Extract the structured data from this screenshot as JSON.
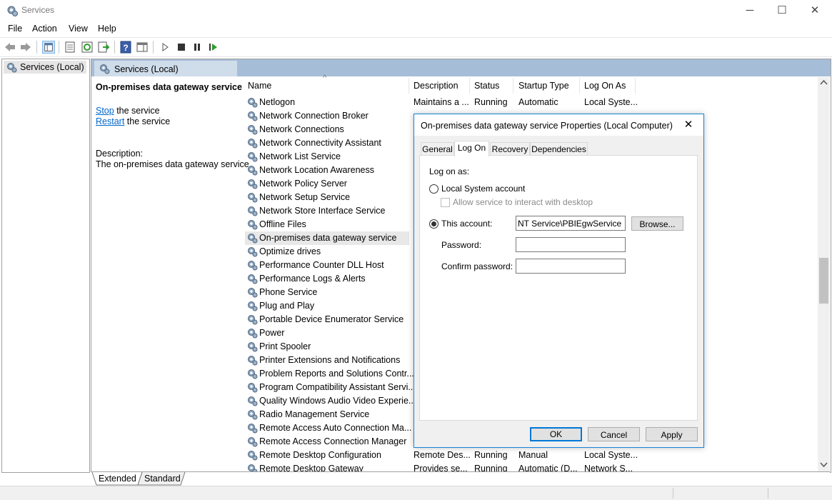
{
  "window": {
    "title": "Services",
    "minimize_glyph": "─",
    "maximize_glyph": "☐",
    "close_glyph": "✕"
  },
  "menu": [
    "File",
    "Action",
    "View",
    "Help"
  ],
  "tree": {
    "root_label": "Services (Local)"
  },
  "right_header": {
    "title": "Services (Local)"
  },
  "detail": {
    "service_name": "On-premises data gateway service",
    "stop_link": "Stop",
    "stop_suffix": " the service",
    "restart_link": "Restart",
    "restart_suffix": " the service",
    "description_label": "Description:",
    "description_text": "The on-premises data gateway service"
  },
  "columns": {
    "name": "Name",
    "description": "Description",
    "status": "Status",
    "startup_type": "Startup Type",
    "log_on_as": "Log On As",
    "sort_glyph": "^"
  },
  "services": [
    {
      "name": "Netlogon",
      "description": "Maintains a ...",
      "status": "Running",
      "startup": "Automatic",
      "logon": "Local Syste..."
    },
    {
      "name": "Network Connection Broker"
    },
    {
      "name": "Network Connections"
    },
    {
      "name": "Network Connectivity Assistant"
    },
    {
      "name": "Network List Service"
    },
    {
      "name": "Network Location Awareness"
    },
    {
      "name": "Network Policy Server"
    },
    {
      "name": "Network Setup Service"
    },
    {
      "name": "Network Store Interface Service"
    },
    {
      "name": "Offline Files"
    },
    {
      "name": "On-premises data gateway service",
      "selected": true
    },
    {
      "name": "Optimize drives"
    },
    {
      "name": "Performance Counter DLL Host"
    },
    {
      "name": "Performance Logs & Alerts"
    },
    {
      "name": "Phone Service"
    },
    {
      "name": "Plug and Play"
    },
    {
      "name": "Portable Device Enumerator Service"
    },
    {
      "name": "Power"
    },
    {
      "name": "Print Spooler"
    },
    {
      "name": "Printer Extensions and Notifications"
    },
    {
      "name": "Problem Reports and Solutions Contr..."
    },
    {
      "name": "Program Compatibility Assistant Servi..."
    },
    {
      "name": "Quality Windows Audio Video Experie..."
    },
    {
      "name": "Radio Management Service"
    },
    {
      "name": "Remote Access Auto Connection Ma..."
    },
    {
      "name": "Remote Access Connection Manager"
    },
    {
      "name": "Remote Desktop Configuration",
      "description": "Remote Des...",
      "status": "Running",
      "startup": "Manual",
      "logon": "Local Syste..."
    },
    {
      "name": "Remote Desktop Gateway",
      "description": "Provides se...",
      "status": "Running",
      "startup": "Automatic (D...",
      "logon": "Network S..."
    }
  ],
  "bottom_tabs": [
    "Extended",
    "Standard"
  ],
  "dialog": {
    "title": "On-premises data gateway service Properties (Local Computer)",
    "close_glyph": "✕",
    "tabs": [
      "General",
      "Log On",
      "Recovery",
      "Dependencies"
    ],
    "active_tab": "Log On",
    "log_on_as_label": "Log on as:",
    "local_system_label": "Local System account",
    "interact_desktop_label": "Allow service to interact with desktop",
    "this_account_label": "This account:",
    "account_value": "NT Service\\PBIEgwService",
    "browse_label": "Browse...",
    "password_label": "Password:",
    "password_value": "",
    "confirm_label": "Confirm password:",
    "confirm_value": "",
    "selected_option": "This account",
    "ok_label": "OK",
    "cancel_label": "Cancel",
    "apply_label": "Apply"
  }
}
